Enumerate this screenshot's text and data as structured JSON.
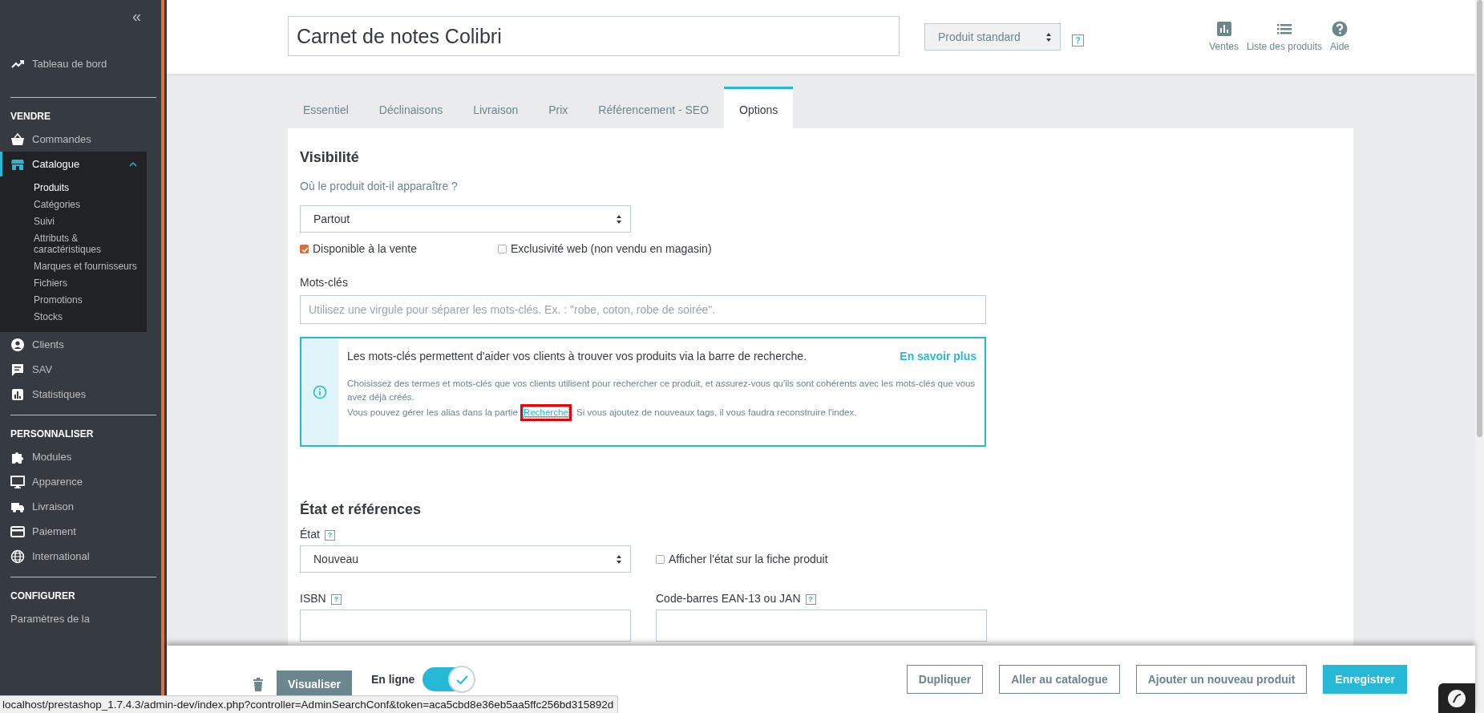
{
  "sidebar": {
    "collapse": "«",
    "sections": [
      {
        "items": [
          {
            "label": "Tableau de bord",
            "selected": false
          }
        ]
      },
      {
        "title": "VENDRE",
        "items": [
          {
            "label": "Commandes",
            "selected": false
          },
          {
            "label": "Catalogue",
            "selected": true,
            "expanded": true,
            "children": [
              {
                "label": "Produits",
                "selected": true
              },
              {
                "label": "Catégories",
                "selected": false
              },
              {
                "label": "Suivi",
                "selected": false
              },
              {
                "label": "Attributs & caractéristiques",
                "selected": false
              },
              {
                "label": "Marques et fournisseurs",
                "selected": false
              },
              {
                "label": "Fichiers",
                "selected": false
              },
              {
                "label": "Promotions",
                "selected": false
              },
              {
                "label": "Stocks",
                "selected": false
              }
            ]
          },
          {
            "label": "Clients",
            "selected": false
          },
          {
            "label": "SAV",
            "selected": false
          },
          {
            "label": "Statistiques",
            "selected": false
          }
        ]
      },
      {
        "title": "PERSONNALISER",
        "items": [
          {
            "label": "Modules",
            "selected": false
          },
          {
            "label": "Apparence",
            "selected": false
          },
          {
            "label": "Livraison",
            "selected": false
          },
          {
            "label": "Paiement",
            "selected": false
          },
          {
            "label": "International",
            "selected": false
          }
        ]
      },
      {
        "title": "CONFIGURER",
        "items": [
          {
            "label": "Paramètres de la",
            "selected": false
          }
        ]
      }
    ]
  },
  "header": {
    "product_name": "Carnet de notes Colibri",
    "product_type": "Produit standard",
    "help": "?",
    "actions": [
      {
        "label": "Ventes"
      },
      {
        "label": "Liste des produits"
      },
      {
        "label": "Aide"
      }
    ]
  },
  "tabs": [
    {
      "label": "Essentiel",
      "selected": false
    },
    {
      "label": "Déclinaisons",
      "selected": false
    },
    {
      "label": "Livraison",
      "selected": false
    },
    {
      "label": "Prix",
      "selected": false
    },
    {
      "label": "Référencement - SEO",
      "selected": false
    },
    {
      "label": "Options",
      "selected": true
    }
  ],
  "visibility": {
    "title": "Visibilité",
    "question": "Où le produit doit-il apparaître ?",
    "select": "Partout",
    "checkboxes": [
      {
        "label": "Disponible à la vente",
        "checked": true
      },
      {
        "label": "Exclusivité web (non vendu en magasin)",
        "checked": false
      }
    ]
  },
  "keywords": {
    "label": "Mots-clés",
    "placeholder": "Utilisez une virgule pour séparer les mots-clés. Ex. : \"robe, coton, robe de soirée\".",
    "info": {
      "headline": "Les mots-clés permettent d'aider vos clients à trouver vos produits via la barre de recherche.",
      "more_link": "En savoir plus",
      "text_1": "Choisissez des termes et mots-clés que vos clients utilisent pour rechercher ce produit, et assurez-vous qu'ils sont cohérents avec les mots-clés que vous avez déjà créés.",
      "text_2_before": "Vous pouvez gérer les alias dans la partie ",
      "text_2_link": "Recherche",
      "text_2_after": ". Si vous ajoutez de nouveaux tags, il vous faudra reconstruire l'index."
    }
  },
  "state": {
    "title": "État et références",
    "condition_label": "État",
    "condition_help": "?",
    "condition_select": "Nouveau",
    "show_condition": {
      "label": "Afficher l'état sur la fiche produit",
      "checked": false
    },
    "isbn_label": "ISBN",
    "isbn_help": "?",
    "ean_label": "Code-barres EAN-13 ou JAN",
    "ean_help": "?"
  },
  "footer": {
    "visualize": "Visualiser",
    "online_label": "En ligne",
    "online": true,
    "buttons": [
      {
        "label": "Dupliquer",
        "kind": "outline"
      },
      {
        "label": "Aller au catalogue",
        "kind": "outline"
      },
      {
        "label": "Ajouter un nouveau produit",
        "kind": "outline"
      },
      {
        "label": "Enregistrer",
        "kind": "primary"
      }
    ]
  },
  "status_bar": {
    "url": "localhost/prestashop_1.7.4.3/admin-dev/index.php?controller=AdminSearchConf&token=aca5cbd8e36eb5aa5ffc256bd315892d"
  }
}
